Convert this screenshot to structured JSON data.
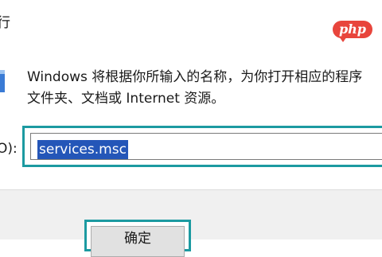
{
  "window": {
    "title": "行"
  },
  "watermark": {
    "text": "php"
  },
  "dialog": {
    "description_line1": "Windows 将根据你所输入的名称，为你打开相应的程序",
    "description_line2": "文件夹、文档或 Internet 资源。",
    "open_label": "O):",
    "input_value": "services.msc",
    "ok_label": "确定"
  },
  "colors": {
    "focus_border": "#1c9aa1",
    "selection": "#2456b8",
    "footer_bg": "#f0f0f0"
  }
}
